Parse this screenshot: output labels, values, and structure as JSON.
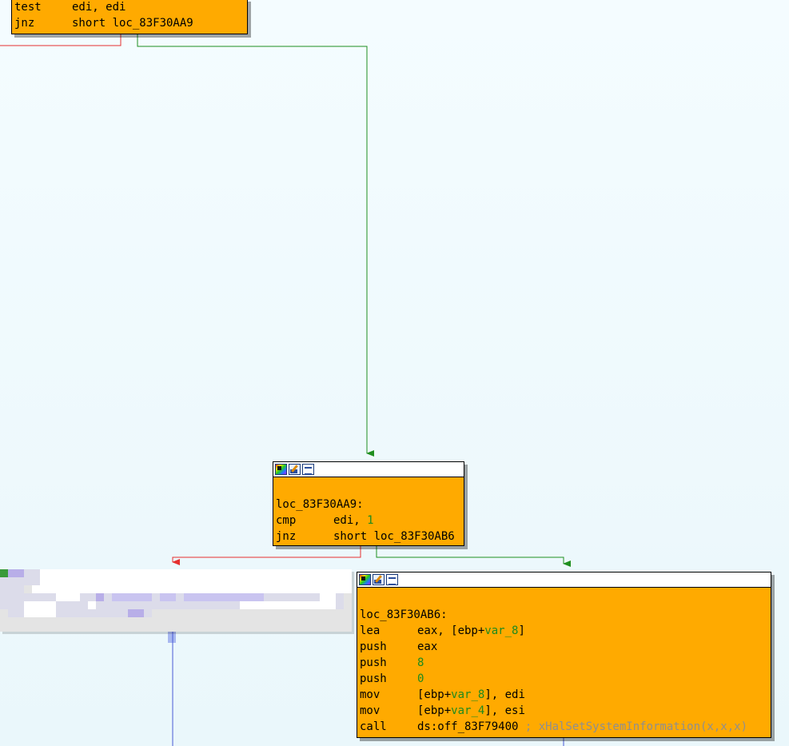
{
  "colors": {
    "node_fill": "#ffaa00",
    "edge_true": "#1f8f1f",
    "edge_false": "#e53030",
    "edge_plain": "#4a5bd6",
    "immediate": "#1e8a1e",
    "comment": "#8f8f8f"
  },
  "node_icons": [
    "color-icon",
    "edit-icon",
    "graph-icon"
  ],
  "top_node": {
    "lines": [
      {
        "mnemonic": "test",
        "operand": "edi, edi"
      },
      {
        "mnemonic": "jnz",
        "operand": "short loc_83F30AA9"
      }
    ]
  },
  "node_aa9": {
    "label": "loc_83F30AA9:",
    "lines": [
      {
        "mnemonic": "cmp",
        "operand": "edi, ",
        "immediate": "1"
      },
      {
        "mnemonic": "jnz",
        "operand": "short loc_83F30AB6"
      }
    ]
  },
  "node_ab6": {
    "label": "loc_83F30AB6:",
    "lines": [
      {
        "mnemonic": "lea",
        "pre": "eax, [ebp+",
        "var": "var_8",
        "post": "]"
      },
      {
        "mnemonic": "push",
        "operand": "eax"
      },
      {
        "mnemonic": "push",
        "immediate": "8"
      },
      {
        "mnemonic": "push",
        "immediate": "0"
      },
      {
        "mnemonic": "mov",
        "pre": "[ebp+",
        "var": "var_8",
        "post": "], edi"
      },
      {
        "mnemonic": "mov",
        "pre": "[ebp+",
        "var": "var_4",
        "post": "], esi"
      },
      {
        "mnemonic": "call",
        "operand": "ds:off_83F79400 ",
        "comment": "; xHalSetSystemInformation(x,x,x)"
      }
    ]
  }
}
